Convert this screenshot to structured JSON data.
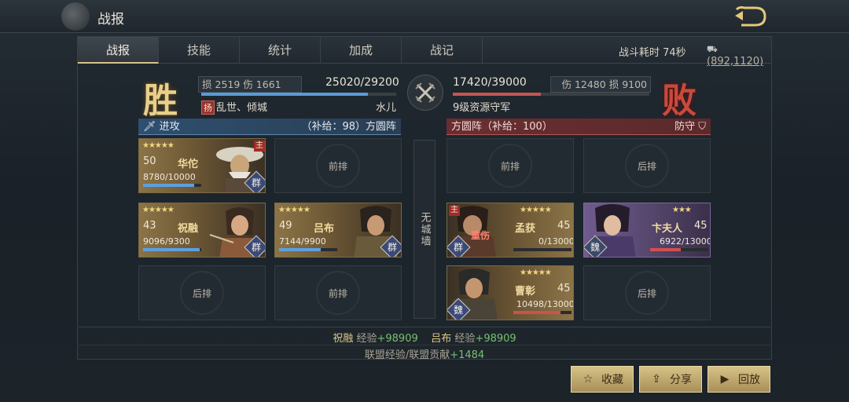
{
  "header": {
    "title": "战报"
  },
  "tabs": [
    {
      "label": "战报"
    },
    {
      "label": "技能"
    },
    {
      "label": "统计"
    },
    {
      "label": "加成"
    },
    {
      "label": "战记"
    }
  ],
  "battle": {
    "duration": "战斗耗时 74秒",
    "coords": "(892,1120)"
  },
  "left": {
    "result": "胜",
    "loss_label": "损",
    "loss": "2519",
    "hurt_label": "伤",
    "hurt": "1661",
    "troops": "25020/29200",
    "troops_value": 25020,
    "troops_max": 29200,
    "tag": "扬",
    "alliance": "乱世、倾城",
    "name": "水儿",
    "side_label": "进攻",
    "formation": "（补给：98）方圆阵"
  },
  "right": {
    "result": "败",
    "troops": "17420/39000",
    "troops_value": 17420,
    "troops_max": 39000,
    "hurt_label": "伤",
    "hurt": "12480",
    "loss_label": "损",
    "loss": "9100",
    "name": "9级资源守军",
    "formation": "方圆阵（补给：100）",
    "side_label": "防守"
  },
  "wall": "无城墙",
  "slots": {
    "front": "前排",
    "back": "后排"
  },
  "heroes": {
    "huatuo": {
      "name": "华佗",
      "level": "50",
      "hp": "8780/10000",
      "hp_ratio": 0.878,
      "faction": "群",
      "main": "主",
      "stars": "★★★★★"
    },
    "zhurong": {
      "name": "祝融",
      "level": "43",
      "hp": "9096/9300",
      "hp_ratio": 0.978,
      "faction": "群",
      "stars": "★★★★★"
    },
    "lvbu": {
      "name": "吕布",
      "level": "49",
      "hp": "7144/9900",
      "hp_ratio": 0.722,
      "faction": "群",
      "stars": "★★★★★"
    },
    "menghuo": {
      "name": "孟获",
      "level": "45",
      "hp": "0/13000",
      "hp_ratio": 0,
      "faction": "群",
      "main": "主",
      "status": "重伤",
      "stars": "★★★★★"
    },
    "bianfuren": {
      "name": "卞夫人",
      "level": "45",
      "hp": "6922/13000",
      "hp_ratio": 0.532,
      "faction": "魏",
      "stars": "★★★"
    },
    "caozhang": {
      "name": "曹彰",
      "level": "45",
      "hp": "10498/13000",
      "hp_ratio": 0.808,
      "faction": "魏",
      "stars": "★★★★★"
    }
  },
  "exp": {
    "n1": "祝融",
    "label1": "经验",
    "v1": "+98909",
    "n2": "吕布",
    "label2": "经验",
    "v2": "+98909",
    "alliance_label": "联盟经验/联盟贡献",
    "alliance_value": "+1484"
  },
  "actions": {
    "favorite": "收藏",
    "share": "分享",
    "replay": "回放"
  },
  "colors": {
    "accent": "#d6c286",
    "win": "#e8cf8c",
    "lose": "#c84a3c",
    "heal": "#77c070"
  }
}
